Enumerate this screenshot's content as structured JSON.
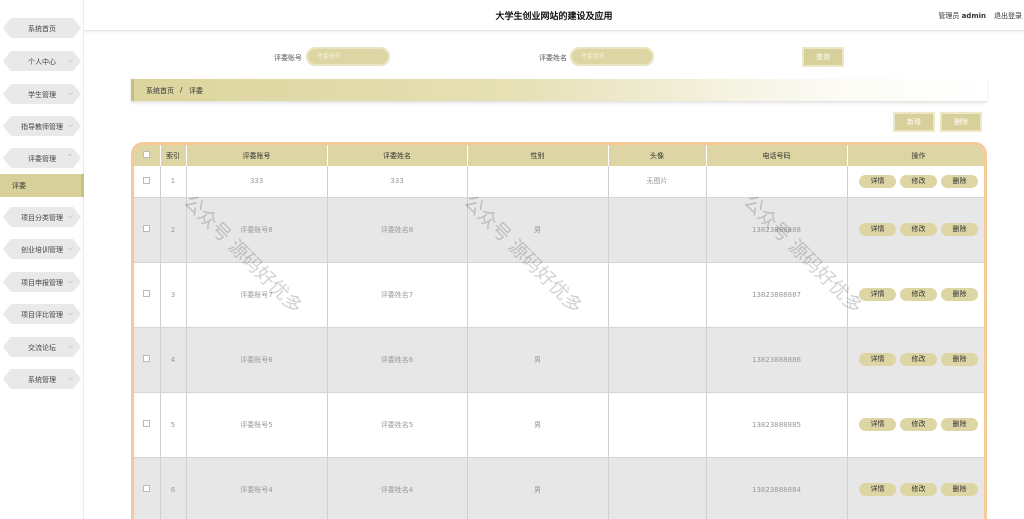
{
  "header": {
    "title": "大学生创业网站的建设及应用",
    "user_role": "管理员",
    "username": "admin",
    "logout": "退出登录"
  },
  "sidebar": {
    "items": [
      {
        "label": "系统首页",
        "has_arrow": false
      },
      {
        "label": "个人中心",
        "has_arrow": true
      },
      {
        "label": "学生管理",
        "has_arrow": true
      },
      {
        "label": "指导教师管理",
        "has_arrow": true
      },
      {
        "label": "评委管理",
        "has_arrow": true
      },
      {
        "label": "项目分类管理",
        "has_arrow": true
      },
      {
        "label": "创业培训管理",
        "has_arrow": true
      },
      {
        "label": "项目申报管理",
        "has_arrow": true
      },
      {
        "label": "项目评比管理",
        "has_arrow": true
      },
      {
        "label": "交流论坛",
        "has_arrow": true
      },
      {
        "label": "系统管理",
        "has_arrow": true
      }
    ],
    "active_sub": "评委"
  },
  "search": {
    "account_label": "评委账号",
    "account_placeholder": "评委账号",
    "name_label": "评委姓名",
    "name_placeholder": "评委姓名",
    "query_button": "查询"
  },
  "breadcrumb": {
    "home": "系统首页",
    "separator": "/",
    "current": "评委"
  },
  "actions": {
    "add": "新增",
    "delete": "删除"
  },
  "table": {
    "columns": [
      "索引",
      "评委账号",
      "评委姓名",
      "性别",
      "头像",
      "电话号码",
      "操作"
    ],
    "row_buttons": [
      "详情",
      "修改",
      "删除"
    ],
    "rows": [
      {
        "index": "1",
        "account": "333",
        "name": "333",
        "gender": "",
        "avatar": "无图片",
        "phone": ""
      },
      {
        "index": "2",
        "account": "评委账号8",
        "name": "评委姓名8",
        "gender": "男",
        "avatar": "",
        "phone": "13823888888"
      },
      {
        "index": "3",
        "account": "评委账号7",
        "name": "评委姓名7",
        "gender": "",
        "avatar": "",
        "phone": "13823888887"
      },
      {
        "index": "4",
        "account": "评委账号6",
        "name": "评委姓名6",
        "gender": "男",
        "avatar": "",
        "phone": "13823888886"
      },
      {
        "index": "5",
        "account": "评委账号5",
        "name": "评委姓名5",
        "gender": "男",
        "avatar": "",
        "phone": "13823888885"
      },
      {
        "index": "6",
        "account": "评委账号4",
        "name": "评委姓名4",
        "gender": "男",
        "avatar": "",
        "phone": "13823888884"
      }
    ]
  },
  "watermark": "公众号 源码好优多",
  "colors": {
    "accent": "#d7d09a",
    "border_orange": "#f5c998",
    "row_gray": "#e7e7e7"
  }
}
